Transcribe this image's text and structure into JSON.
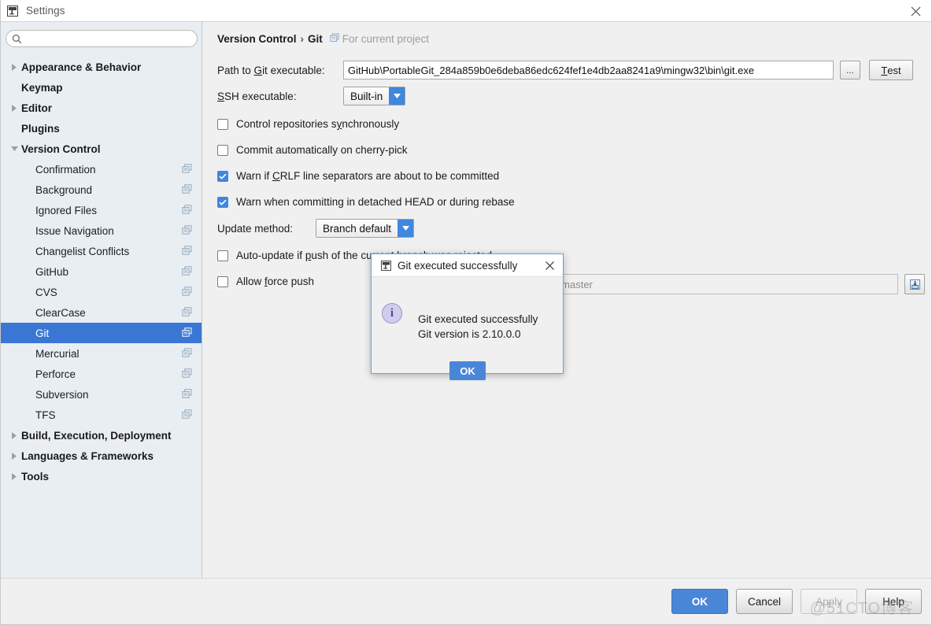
{
  "window": {
    "title": "Settings",
    "icon": "intellij-icon",
    "close_icon": "close-icon"
  },
  "sidebar": {
    "search": {
      "value": "",
      "placeholder": "",
      "icon": "search-icon"
    },
    "items": [
      {
        "label": "Appearance & Behavior",
        "level": "top",
        "arrow": "collapsed",
        "config_icon": false,
        "selected": false
      },
      {
        "label": "Keymap",
        "level": "top",
        "arrow": "none",
        "config_icon": false,
        "selected": false
      },
      {
        "label": "Editor",
        "level": "top",
        "arrow": "collapsed",
        "config_icon": false,
        "selected": false
      },
      {
        "label": "Plugins",
        "level": "top",
        "arrow": "none",
        "config_icon": false,
        "selected": false
      },
      {
        "label": "Version Control",
        "level": "top",
        "arrow": "expanded",
        "config_icon": false,
        "selected": false
      },
      {
        "label": "Confirmation",
        "level": "child",
        "arrow": "none",
        "config_icon": true,
        "selected": false
      },
      {
        "label": "Background",
        "level": "child",
        "arrow": "none",
        "config_icon": true,
        "selected": false
      },
      {
        "label": "Ignored Files",
        "level": "child",
        "arrow": "none",
        "config_icon": true,
        "selected": false
      },
      {
        "label": "Issue Navigation",
        "level": "child",
        "arrow": "none",
        "config_icon": true,
        "selected": false
      },
      {
        "label": "Changelist Conflicts",
        "level": "child",
        "arrow": "none",
        "config_icon": true,
        "selected": false
      },
      {
        "label": "GitHub",
        "level": "child",
        "arrow": "none",
        "config_icon": true,
        "selected": false
      },
      {
        "label": "CVS",
        "level": "child",
        "arrow": "none",
        "config_icon": true,
        "selected": false
      },
      {
        "label": "ClearCase",
        "level": "child",
        "arrow": "none",
        "config_icon": true,
        "selected": false
      },
      {
        "label": "Git",
        "level": "child",
        "arrow": "none",
        "config_icon": true,
        "selected": true
      },
      {
        "label": "Mercurial",
        "level": "child",
        "arrow": "none",
        "config_icon": true,
        "selected": false
      },
      {
        "label": "Perforce",
        "level": "child",
        "arrow": "none",
        "config_icon": true,
        "selected": false
      },
      {
        "label": "Subversion",
        "level": "child",
        "arrow": "none",
        "config_icon": true,
        "selected": false
      },
      {
        "label": "TFS",
        "level": "child",
        "arrow": "none",
        "config_icon": true,
        "selected": false
      },
      {
        "label": "Build, Execution, Deployment",
        "level": "top",
        "arrow": "collapsed",
        "config_icon": false,
        "selected": false
      },
      {
        "label": "Languages & Frameworks",
        "level": "top",
        "arrow": "collapsed",
        "config_icon": false,
        "selected": false
      },
      {
        "label": "Tools",
        "level": "top",
        "arrow": "collapsed",
        "config_icon": false,
        "selected": false
      }
    ]
  },
  "main": {
    "breadcrumb": {
      "root": "Version Control",
      "separator": "›",
      "current": "Git",
      "scope": "For current project",
      "scope_icon": "project-scope-icon"
    },
    "path_row": {
      "label_pre": "Path to ",
      "label_accel": "G",
      "label_post": "it executable:",
      "value": "GitHub\\PortableGit_284a859b0e6deba86edc624fef1e4db2aa8241a9\\mingw32\\bin\\git.exe",
      "browse_label": "...",
      "test_pre": "T",
      "test_post": "est"
    },
    "ssh_row": {
      "label_accel": "S",
      "label_post": "SH executable:",
      "value": "Built-in",
      "arrow_icon": "chevron-down-icon"
    },
    "checkboxes": [
      {
        "checked": false,
        "pre": "Control repositories s",
        "accel": "y",
        "post": "nchronously"
      },
      {
        "checked": false,
        "pre": "Commit automatically on cherry-pick",
        "accel": "",
        "post": ""
      },
      {
        "checked": true,
        "pre": "Warn if ",
        "accel": "C",
        "post": "RLF line separators are about to be committed"
      },
      {
        "checked": true,
        "pre": "Warn when committing in detached HEAD or during rebase",
        "accel": "",
        "post": ""
      }
    ],
    "update_row": {
      "label": "Update method:",
      "value": "Branch default",
      "arrow_icon": "chevron-down-icon"
    },
    "lower_checkboxes": [
      {
        "checked": false,
        "pre": "Auto-update if ",
        "accel": "p",
        "post": "ush of the current branch was rejected"
      },
      {
        "checked": false,
        "pre": "Allow ",
        "accel": "f",
        "post": "orce push"
      }
    ],
    "protected_branches": {
      "value": "master",
      "expand_icon": "expand-field-icon"
    }
  },
  "dialog": {
    "title": "Git executed successfully",
    "title_icon": "intellij-icon",
    "close_icon": "close-icon",
    "info_icon": "info-icon",
    "info_glyph": "i",
    "message_line1": "Git executed successfully",
    "message_line2": "Git version is 2.10.0.0",
    "ok_label": "OK"
  },
  "footer": {
    "buttons": [
      {
        "label": "OK",
        "style": "primary"
      },
      {
        "label": "Cancel",
        "style": "normal"
      },
      {
        "label": "Apply",
        "style": "disabled"
      },
      {
        "label": "Help",
        "style": "normal"
      }
    ],
    "watermark": "@51CTO博客"
  },
  "colors": {
    "accent": "#3f87df",
    "selection": "#3a77d4",
    "primary_button": "#4a86d8",
    "sidebar_bg": "#e9eef2",
    "panel_bg": "#f0f0f0"
  }
}
